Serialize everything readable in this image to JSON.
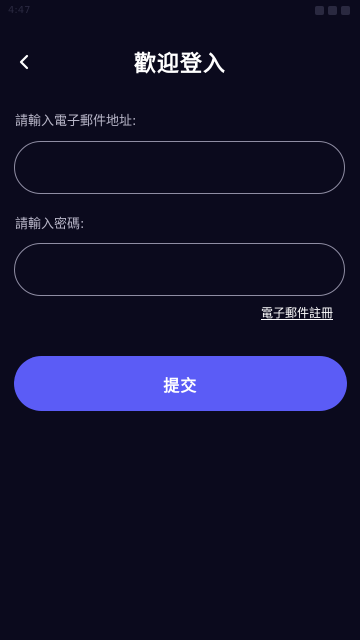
{
  "status_bar": {
    "time": "4:47"
  },
  "header": {
    "title": "歡迎登入",
    "back_icon": "chevron-left-icon"
  },
  "form": {
    "email_label": "請輸入電子郵件地址:",
    "email_value": "",
    "password_label": "請輸入密碼:",
    "password_value": "",
    "register_link": "電子郵件註冊",
    "submit_label": "提交"
  },
  "colors": {
    "background": "#0b0a1d",
    "accent": "#5b5cf6",
    "input_border": "#8f8da3",
    "label": "#b8b6c8"
  }
}
